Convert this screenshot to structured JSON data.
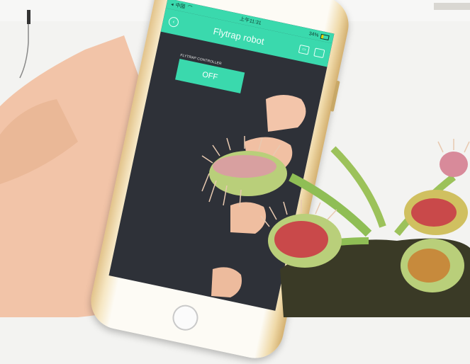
{
  "status_bar": {
    "carrier": "中国",
    "time": "上午11:31",
    "battery": "34%"
  },
  "app_bar": {
    "title": "Flytrap robot",
    "left_icon": "back-circle-icon",
    "right_icons": [
      "battery-settings-icon",
      "square-icon"
    ]
  },
  "widget": {
    "label": "FLYTRAP CONTROLLER",
    "button_text": "OFF",
    "state": "off"
  },
  "colors": {
    "accent": "#3ad9ad",
    "screen_bg": "#2e3138",
    "phone_frame": "#e2c38a",
    "skin": "#f2c8ae",
    "plant_green": "#9cc25a",
    "trap_red": "#c9494a"
  }
}
